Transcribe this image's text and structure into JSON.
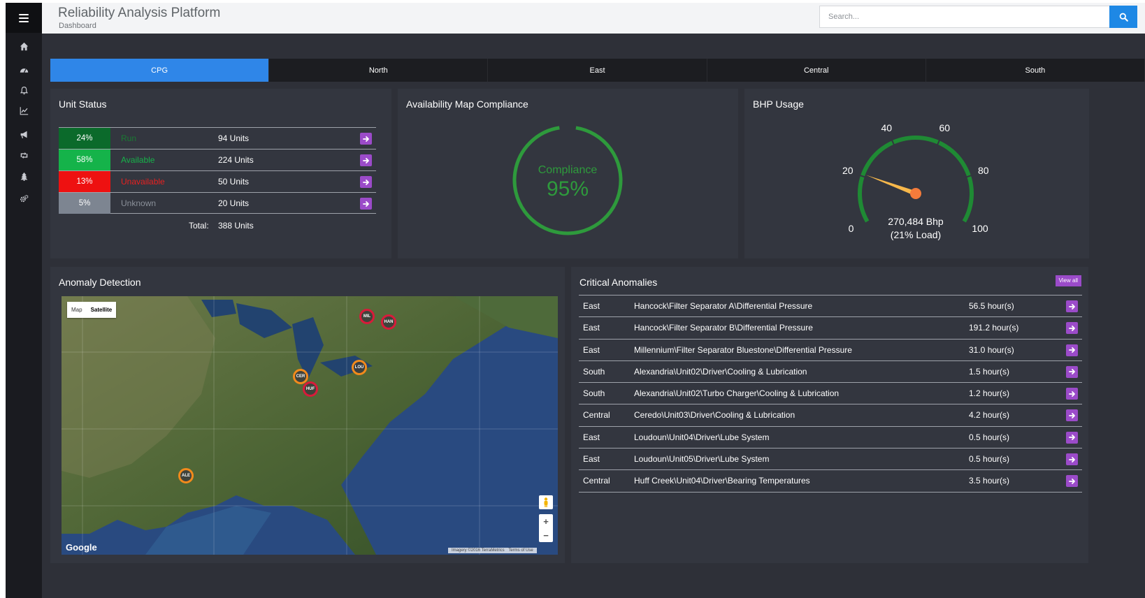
{
  "header": {
    "title": "Reliability Analysis Platform",
    "breadcrumb": "Dashboard",
    "search_placeholder": "Search..."
  },
  "sidebar": {
    "items": [
      {
        "icon": "home-icon"
      },
      {
        "icon": "dashboard-icon"
      },
      {
        "icon": "bell-icon"
      },
      {
        "icon": "line-chart-icon"
      },
      {
        "icon": "megaphone-icon"
      },
      {
        "icon": "retweet-icon"
      },
      {
        "icon": "tree-icon"
      },
      {
        "icon": "gears-icon"
      }
    ]
  },
  "tabs": [
    {
      "label": "CPG",
      "active": true
    },
    {
      "label": "North",
      "active": false
    },
    {
      "label": "East",
      "active": false
    },
    {
      "label": "Central",
      "active": false
    },
    {
      "label": "South",
      "active": false
    }
  ],
  "unit_status": {
    "title": "Unit Status",
    "rows": [
      {
        "pct": "24%",
        "label": "Run",
        "units": "94 Units",
        "color": "#0b6a2b",
        "text_color": "#1a7a33"
      },
      {
        "pct": "58%",
        "label": "Available",
        "units": "224 Units",
        "color": "#15b34a",
        "text_color": "#16b34a"
      },
      {
        "pct": "13%",
        "label": "Unavailable",
        "units": "50 Units",
        "color": "#ee1111",
        "text_color": "#e82020"
      },
      {
        "pct": "5%",
        "label": "Unknown",
        "units": "20 Units",
        "color": "#7d8591",
        "text_color": "#8a9099"
      }
    ],
    "total_label": "Total:",
    "total_value": "388 Units"
  },
  "compliance": {
    "title": "Availability Map Compliance",
    "label": "Compliance",
    "value": "95%",
    "fraction": 0.95,
    "color": "#2e9a3c"
  },
  "bhp": {
    "title": "BHP Usage",
    "ticks": [
      "0",
      "20",
      "40",
      "60",
      "80",
      "100"
    ],
    "value": "270,484 Bhp",
    "load": "(21% Load)",
    "load_fraction": 0.21,
    "color": "#1f8a34"
  },
  "anomaly_detection": {
    "title": "Anomaly Detection",
    "map_type": {
      "map": "Map",
      "satellite": "Satellite",
      "selected": "Satellite"
    },
    "markers": [
      {
        "code": "MIL",
        "status": "red"
      },
      {
        "code": "HAN",
        "status": "red"
      },
      {
        "code": "LOU",
        "status": "orange"
      },
      {
        "code": "CER",
        "status": "orange"
      },
      {
        "code": "HUF",
        "status": "red"
      },
      {
        "code": "ALE",
        "status": "orange"
      }
    ],
    "zoom_in": "+",
    "zoom_out": "−",
    "logo": "Google",
    "credits": [
      "Imagery ©2016 TerraMetrics",
      "Terms of Use"
    ]
  },
  "critical_anomalies": {
    "title": "Critical Anomalies",
    "view_all": "View all",
    "rows": [
      {
        "region": "East",
        "path": "Hancock\\Filter Separator A\\Differential Pressure",
        "duration": "56.5 hour(s)"
      },
      {
        "region": "East",
        "path": "Hancock\\Filter Separator B\\Differential Pressure",
        "duration": "191.2 hour(s)"
      },
      {
        "region": "East",
        "path": "Millennium\\Filter Separator Bluestone\\Differential Pressure",
        "duration": "31.0 hour(s)"
      },
      {
        "region": "South",
        "path": "Alexandria\\Unit02\\Driver\\Cooling & Lubrication",
        "duration": "1.5 hour(s)"
      },
      {
        "region": "South",
        "path": "Alexandria\\Unit02\\Turbo Charger\\Cooling & Lubrication",
        "duration": "1.2 hour(s)"
      },
      {
        "region": "Central",
        "path": "Ceredo\\Unit03\\Driver\\Cooling & Lubrication",
        "duration": "4.2 hour(s)"
      },
      {
        "region": "East",
        "path": "Loudoun\\Unit04\\Driver\\Lube System",
        "duration": "0.5 hour(s)"
      },
      {
        "region": "East",
        "path": "Loudoun\\Unit05\\Driver\\Lube System",
        "duration": "0.5 hour(s)"
      },
      {
        "region": "Central",
        "path": "Huff Creek\\Unit04\\Driver\\Bearing Temperatures",
        "duration": "3.5 hour(s)"
      }
    ]
  }
}
